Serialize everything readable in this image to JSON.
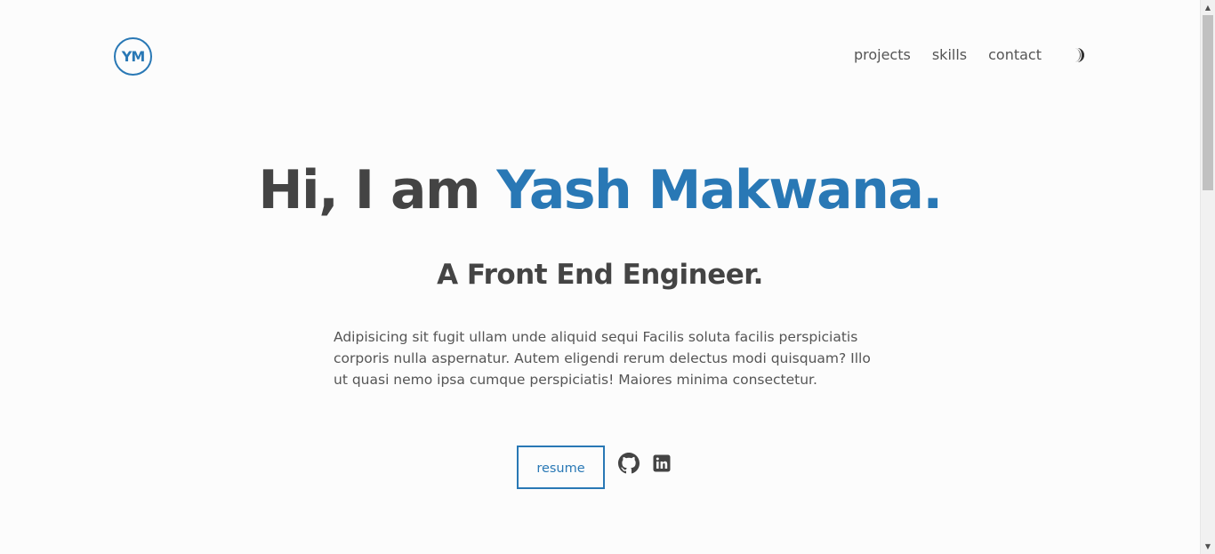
{
  "header": {
    "logo_text": "YM",
    "nav": [
      "projects",
      "skills",
      "contact"
    ],
    "theme_toggle_icon": "half-moon-icon"
  },
  "hero": {
    "greeting": "Hi, I am ",
    "name": "Yash Makwana.",
    "subtitle": "A Front End Engineer.",
    "about": "Adipisicing sit fugit ullam unde aliquid sequi Facilis soluta facilis perspiciatis corporis nulla aspernatur. Autem eligendi rerum delectus modi quisquam? Illo ut quasi nemo ipsa cumque perspiciatis! Maiores minima consectetur.",
    "resume_label": "resume",
    "social_icons": [
      "github-icon",
      "linkedin-icon"
    ]
  },
  "colors": {
    "accent": "#2978b5",
    "text": "#444444",
    "background": "#fcfcfc"
  }
}
